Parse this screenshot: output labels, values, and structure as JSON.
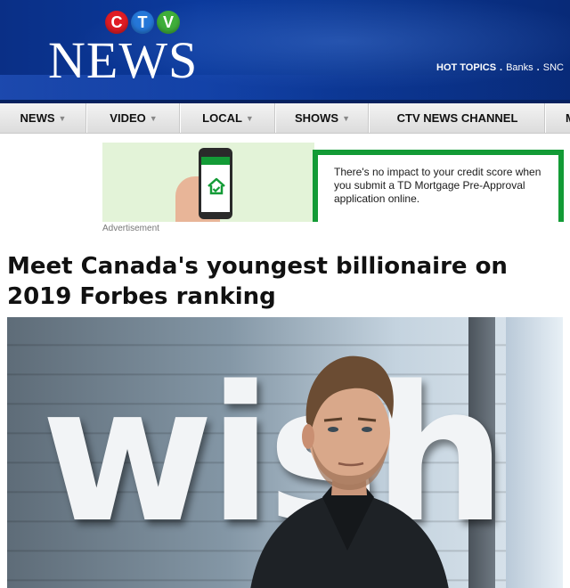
{
  "header": {
    "logo_letters": [
      "C",
      "T",
      "V"
    ],
    "logo_word": "NEWS",
    "hot_topics_label": "HOT TOPICS",
    "hot_topics": [
      "Banks",
      "SNC"
    ]
  },
  "nav": {
    "items": [
      {
        "label": "NEWS",
        "has_caret": true
      },
      {
        "label": "VIDEO",
        "has_caret": true
      },
      {
        "label": "LOCAL",
        "has_caret": true
      },
      {
        "label": "SHOWS",
        "has_caret": true
      },
      {
        "label": "CTV NEWS CHANNEL",
        "has_caret": false
      },
      {
        "label": "M",
        "has_caret": false
      }
    ]
  },
  "ad": {
    "text": "There's no impact to your credit score when you submit a TD Mortgage Pre-Approval application online.",
    "label": "Advertisement"
  },
  "article": {
    "headline": "Meet Canada's youngest billionaire on 2019 Forbes ranking"
  },
  "photo": {
    "sign_text": "wish"
  },
  "colors": {
    "header_blue": "#0b3a9d",
    "td_green": "#139b36",
    "ctv_red": "#e01c24",
    "ctv_blue": "#2577d8",
    "ctv_green": "#3fae3a"
  }
}
